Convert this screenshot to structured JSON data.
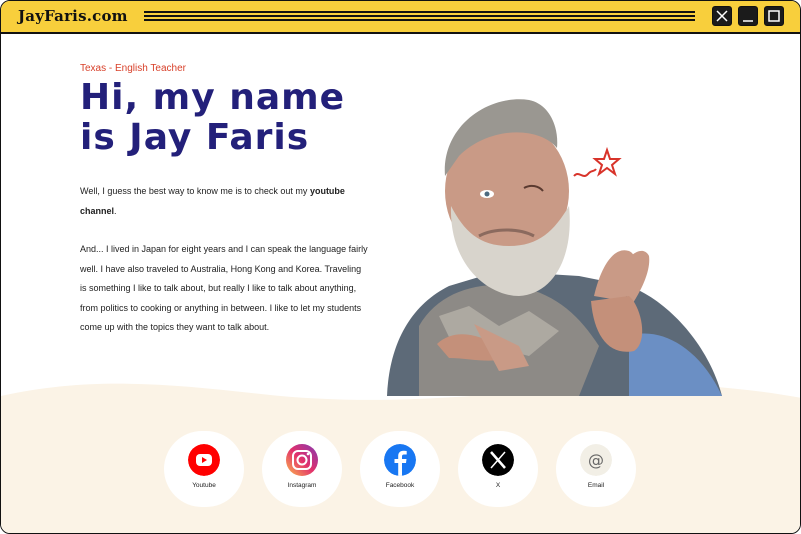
{
  "window": {
    "logo": "JayFaris.com",
    "controls": {
      "close_icon": "close-icon",
      "minimize_icon": "minimize-icon",
      "maximize_icon": "maximize-icon"
    }
  },
  "hero": {
    "subtitle": "Texas - English Teacher",
    "headline_line1": "Hi, my name",
    "headline_line2": "is Jay Faris",
    "intro_text": "Well, I guess the best way to know me is to check out my ",
    "intro_link": "youtube channel",
    "intro_end": ".",
    "bio": "And... I lived in Japan for eight years and I can speak the language fairly well. I have also traveled to Australia, Hong Kong and Korea. Traveling is something I like to talk about, but really I like to talk about anything, from politics to cooking or anything in between. I like to let my students come up with the topics they want to talk about."
  },
  "socials": [
    {
      "label": "Youtube",
      "icon": "youtube-icon",
      "color": "#ff0000"
    },
    {
      "label": "Instagram",
      "icon": "instagram-icon",
      "color": "#e1306c"
    },
    {
      "label": "Facebook",
      "icon": "facebook-icon",
      "color": "#1877f2"
    },
    {
      "label": "X",
      "icon": "x-icon",
      "color": "#000000"
    },
    {
      "label": "Email",
      "icon": "email-icon",
      "color": "#f2efe6"
    }
  ],
  "colors": {
    "titlebar": "#f8cf3c",
    "headline": "#23207a",
    "subtitle": "#d8402a",
    "wave": "#fbf3e6"
  }
}
